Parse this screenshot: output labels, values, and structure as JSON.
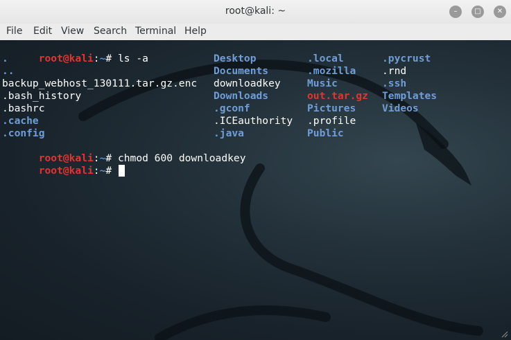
{
  "window": {
    "title": "root@kali: ~",
    "buttons": {
      "minimize": "–",
      "maximize": "□",
      "close": "✕"
    }
  },
  "menu": {
    "items": [
      "File",
      "Edit",
      "View",
      "Search",
      "Terminal",
      "Help"
    ]
  },
  "colors": {
    "prompt_user": "#e3342f",
    "prompt_path": "#5a8fd1",
    "directory": "#6f9ed8",
    "archive": "#e3342f",
    "text": "#ffffff"
  },
  "terminal": {
    "prompt": {
      "user": "root@kali",
      "sep": ":",
      "path": "~",
      "suffix": "# "
    },
    "commands": [
      "ls -a",
      "chmod 600 downloadkey",
      ""
    ],
    "ls": {
      "col1": [
        {
          "text": ".",
          "type": "dir"
        },
        {
          "text": "..",
          "type": "dir"
        },
        {
          "text": "backup_webhost_130111.tar.gz.enc",
          "type": "file"
        },
        {
          "text": ".bash_history",
          "type": "file"
        },
        {
          "text": ".bashrc",
          "type": "file"
        },
        {
          "text": ".cache",
          "type": "dir"
        },
        {
          "text": ".config",
          "type": "dir"
        }
      ],
      "col2": [
        {
          "text": "Desktop",
          "type": "dir"
        },
        {
          "text": "Documents",
          "type": "dir"
        },
        {
          "text": "downloadkey",
          "type": "file"
        },
        {
          "text": "Downloads",
          "type": "dir"
        },
        {
          "text": ".gconf",
          "type": "dir"
        },
        {
          "text": ".ICEauthority",
          "type": "file"
        },
        {
          "text": ".java",
          "type": "dir"
        }
      ],
      "col3": [
        {
          "text": ".local",
          "type": "dir"
        },
        {
          "text": ".mozilla",
          "type": "dir"
        },
        {
          "text": "Music",
          "type": "dir"
        },
        {
          "text": "out.tar.gz",
          "type": "archive"
        },
        {
          "text": "Pictures",
          "type": "dir"
        },
        {
          "text": ".profile",
          "type": "file"
        },
        {
          "text": "Public",
          "type": "dir"
        }
      ],
      "col4": [
        {
          "text": ".pycrust",
          "type": "dir"
        },
        {
          "text": ".rnd",
          "type": "file"
        },
        {
          "text": ".ssh",
          "type": "dir"
        },
        {
          "text": "Templates",
          "type": "dir"
        },
        {
          "text": "Videos",
          "type": "dir"
        }
      ]
    }
  }
}
